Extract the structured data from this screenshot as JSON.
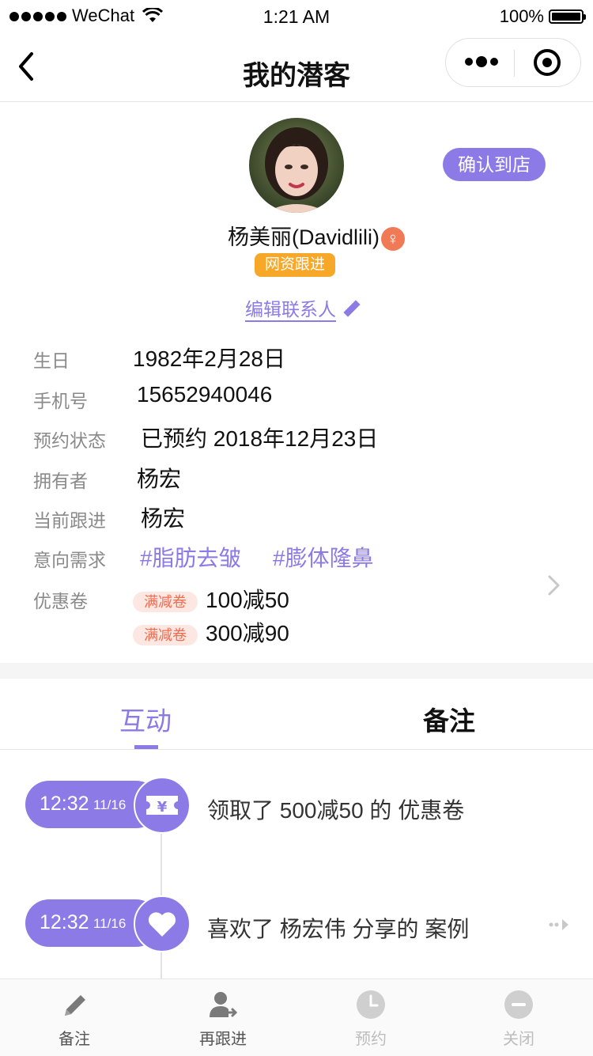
{
  "status_bar": {
    "carrier": "WeChat",
    "time": "1:21 AM",
    "battery": "100%"
  },
  "nav": {
    "title": "我的潜客"
  },
  "profile": {
    "confirm_button": "确认到店",
    "name": "杨美丽(Davidlili)",
    "gender_symbol": "♀",
    "tag": "网资跟进",
    "edit_contact": "编辑联系人"
  },
  "info": {
    "birthday_label": "生日",
    "birthday": "1982年2月28日",
    "phone_label": "手机号",
    "phone": "15652940046",
    "appointment_label": "预约状态",
    "appointment": "已预约 2018年12月23日",
    "owner_label": "拥有者",
    "owner": "杨宏",
    "follower_label": "当前跟进",
    "follower": "杨宏",
    "intent_label": "意向需求",
    "intents": [
      "#脂肪去皱",
      "#膨体隆鼻"
    ],
    "coupon_label": "优惠卷",
    "coupons": [
      {
        "tag": "满减卷",
        "value": "100减50"
      },
      {
        "tag": "满减卷",
        "value": "300减90"
      }
    ]
  },
  "tabs": [
    {
      "label": "互动",
      "active": true
    },
    {
      "label": "备注",
      "active": false
    }
  ],
  "timeline": [
    {
      "time": "12:32",
      "date": "11/16",
      "icon": "ticket-yen-icon",
      "text": "领取了 500减50 的 优惠卷"
    },
    {
      "time": "12:32",
      "date": "11/16",
      "icon": "heart-icon",
      "text": "喜欢了 杨宏伟 分享的 案例"
    }
  ],
  "bottom_bar": [
    {
      "label": "备注",
      "icon": "pencil-icon",
      "enabled": true
    },
    {
      "label": "再跟进",
      "icon": "user-forward-icon",
      "enabled": true
    },
    {
      "label": "预约",
      "icon": "clock-icon",
      "enabled": false
    },
    {
      "label": "关闭",
      "icon": "minus-circle-icon",
      "enabled": false
    }
  ],
  "colors": {
    "accent": "#8c7ae6",
    "orange": "#f7a829",
    "coupon_bg": "#fde7e2",
    "coupon_text": "#f26a4c",
    "gender": "#f07a55",
    "disabled": "#bdbdbd"
  }
}
